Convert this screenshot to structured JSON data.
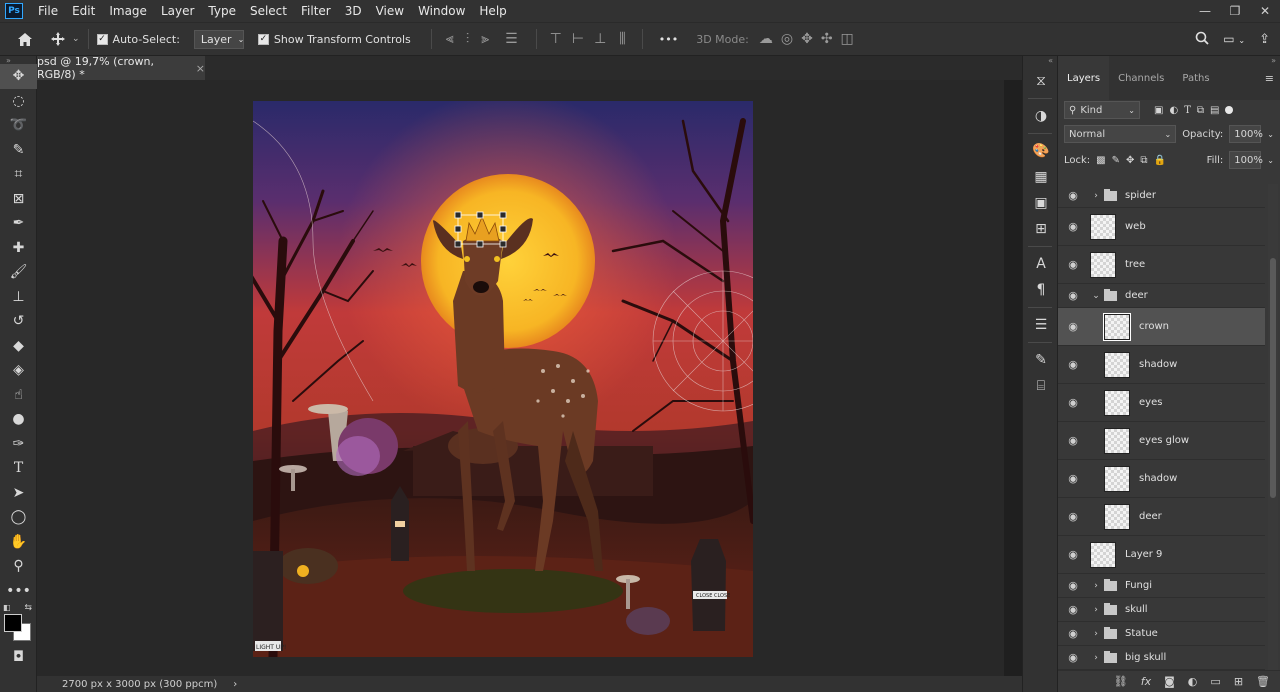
{
  "app": {
    "logo": "Ps"
  },
  "menu": [
    "File",
    "Edit",
    "Image",
    "Layer",
    "Type",
    "Select",
    "Filter",
    "3D",
    "View",
    "Window",
    "Help"
  ],
  "window_controls": {
    "minimize": "—",
    "restore": "❐",
    "close": "✕"
  },
  "options": {
    "auto_select_label": "Auto-Select:",
    "auto_select_checked": true,
    "auto_select_target": "Layer",
    "show_transform_label": "Show Transform Controls",
    "show_transform_checked": true,
    "mode_3d_label": "3D Mode:",
    "more": "•••"
  },
  "document": {
    "tab_title": "psd @ 19,7% (crown, RGB/8) *",
    "close": "×",
    "status": "2700 px x 3000 px (300 ppcm)",
    "status_arrow": "›"
  },
  "artwork": {
    "sign_right": "CLOSE CLOSE",
    "sign_left": "LIGHT UP!"
  },
  "layers_panel": {
    "tabs": [
      "Layers",
      "Channels",
      "Paths"
    ],
    "filter_kind": "Kind",
    "blend_mode": "Normal",
    "opacity_label": "Opacity:",
    "opacity_value": "100%",
    "lock_label": "Lock:",
    "fill_label": "Fill:",
    "fill_value": "100%",
    "layers": [
      {
        "name": "spider",
        "type": "group",
        "expanded": false,
        "indent": 0
      },
      {
        "name": "web",
        "type": "layer",
        "indent": 0
      },
      {
        "name": "tree",
        "type": "layer",
        "indent": 0
      },
      {
        "name": "deer",
        "type": "group",
        "expanded": true,
        "indent": 0
      },
      {
        "name": "crown",
        "type": "layer",
        "indent": 1,
        "selected": true
      },
      {
        "name": "shadow",
        "type": "layer",
        "indent": 1
      },
      {
        "name": "eyes",
        "type": "layer",
        "indent": 1
      },
      {
        "name": "eyes glow",
        "type": "layer",
        "indent": 1
      },
      {
        "name": "shadow",
        "type": "layer",
        "indent": 1
      },
      {
        "name": "deer",
        "type": "layer",
        "indent": 1
      },
      {
        "name": "Layer 9",
        "type": "layer",
        "indent": 0
      },
      {
        "name": "Fungi",
        "type": "group",
        "expanded": false,
        "indent": 0
      },
      {
        "name": "skull",
        "type": "group",
        "expanded": false,
        "indent": 0
      },
      {
        "name": "Statue",
        "type": "group",
        "expanded": false,
        "indent": 0
      },
      {
        "name": "big skull",
        "type": "group",
        "expanded": false,
        "indent": 0
      }
    ]
  },
  "colors": {
    "accent": "#31a8ff",
    "panel": "#383838",
    "ui_bg": "#323232"
  }
}
